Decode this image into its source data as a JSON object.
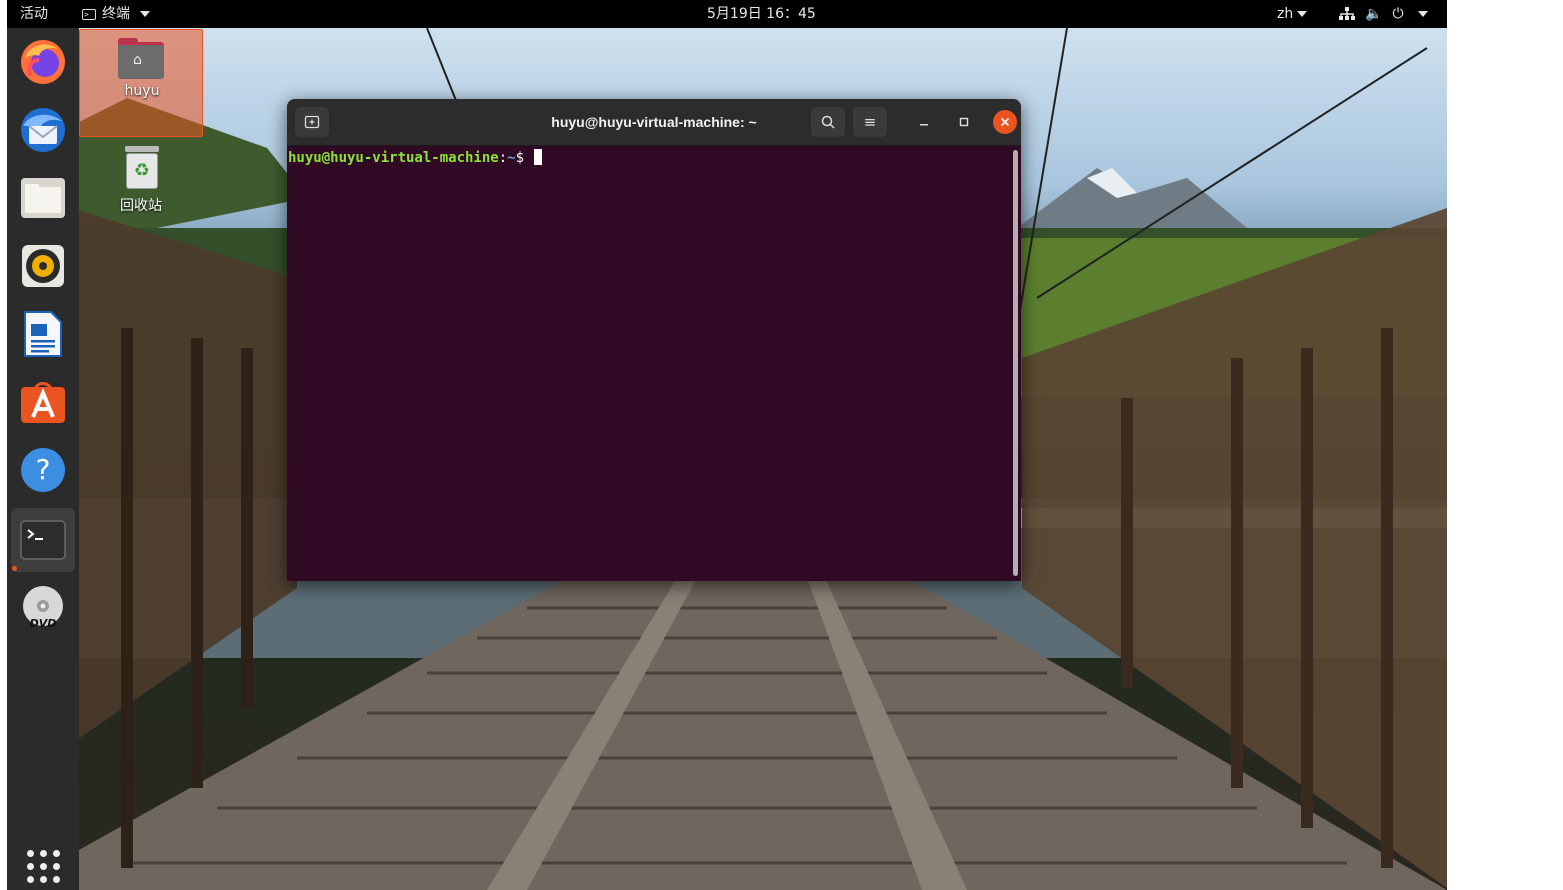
{
  "topbar": {
    "activities": "活动",
    "app_menu": "终端",
    "clock": "5月19日  16：45",
    "lang": "zh"
  },
  "dock": {
    "items": [
      "firefox-icon",
      "thunderbird-icon",
      "files-icon",
      "rhythmbox-icon",
      "writer-icon",
      "software-icon",
      "help-icon",
      "terminal-icon",
      "dvd-icon"
    ],
    "active": "terminal-icon"
  },
  "desktop": {
    "home_label": "huyu",
    "trash_label": "回收站"
  },
  "terminal": {
    "title": "huyu@huyu-virtual-machine: ~",
    "prompt_user": "huyu@huyu-virtual-machine",
    "prompt_sep": ":",
    "prompt_path": "~",
    "prompt_symbol": "$ "
  },
  "colors": {
    "accent": "#e95420",
    "terminal_bg": "#300a24",
    "prompt_user": "#8ae234",
    "prompt_path": "#729fcf"
  }
}
